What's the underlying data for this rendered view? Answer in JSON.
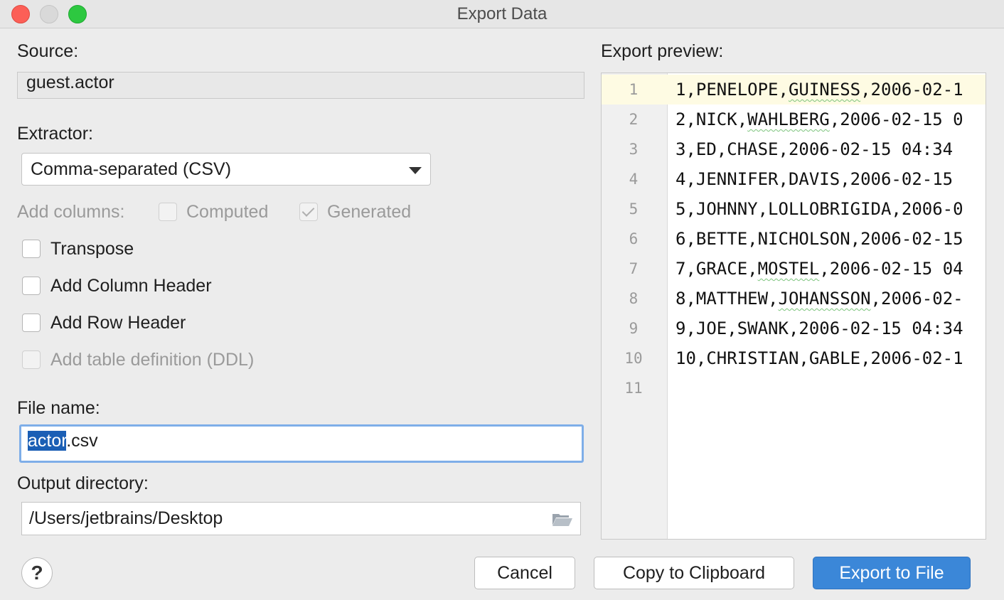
{
  "window": {
    "title": "Export Data"
  },
  "source": {
    "label": "Source:",
    "value": "guest.actor"
  },
  "extractor": {
    "label": "Extractor:",
    "selected": "Comma-separated (CSV)"
  },
  "add_columns": {
    "label": "Add columns:",
    "computed": "Computed",
    "generated": "Generated"
  },
  "options": {
    "transpose": "Transpose",
    "add_column_header": "Add Column Header",
    "add_row_header": "Add Row Header",
    "add_table_definition": "Add table definition (DDL)"
  },
  "file_name": {
    "label": "File name:",
    "selected_part": "actor",
    "rest": ".csv"
  },
  "output_directory": {
    "label": "Output directory:",
    "value": "/Users/jetbrains/Desktop"
  },
  "preview": {
    "label": "Export preview:",
    "lines": [
      {
        "n": "1",
        "text": "1,PENELOPE,GUINESS,2006-02-1"
      },
      {
        "n": "2",
        "text": "2,NICK,WAHLBERG,2006-02-15 0"
      },
      {
        "n": "3",
        "text": "3,ED,CHASE,2006-02-15 04:34"
      },
      {
        "n": "4",
        "text": "4,JENNIFER,DAVIS,2006-02-15"
      },
      {
        "n": "5",
        "text": "5,JOHNNY,LOLLOBRIGIDA,2006-0"
      },
      {
        "n": "6",
        "text": "6,BETTE,NICHOLSON,2006-02-15"
      },
      {
        "n": "7",
        "text": "7,GRACE,MOSTEL,2006-02-15 04"
      },
      {
        "n": "8",
        "text": "8,MATTHEW,JOHANSSON,2006-02-"
      },
      {
        "n": "9",
        "text": "9,JOE,SWANK,2006-02-15 04:34"
      },
      {
        "n": "10",
        "text": "10,CHRISTIAN,GABLE,2006-02-1"
      },
      {
        "n": "11",
        "text": ""
      }
    ]
  },
  "buttons": {
    "help": "?",
    "cancel": "Cancel",
    "copy": "Copy to Clipboard",
    "export": "Export to File"
  }
}
